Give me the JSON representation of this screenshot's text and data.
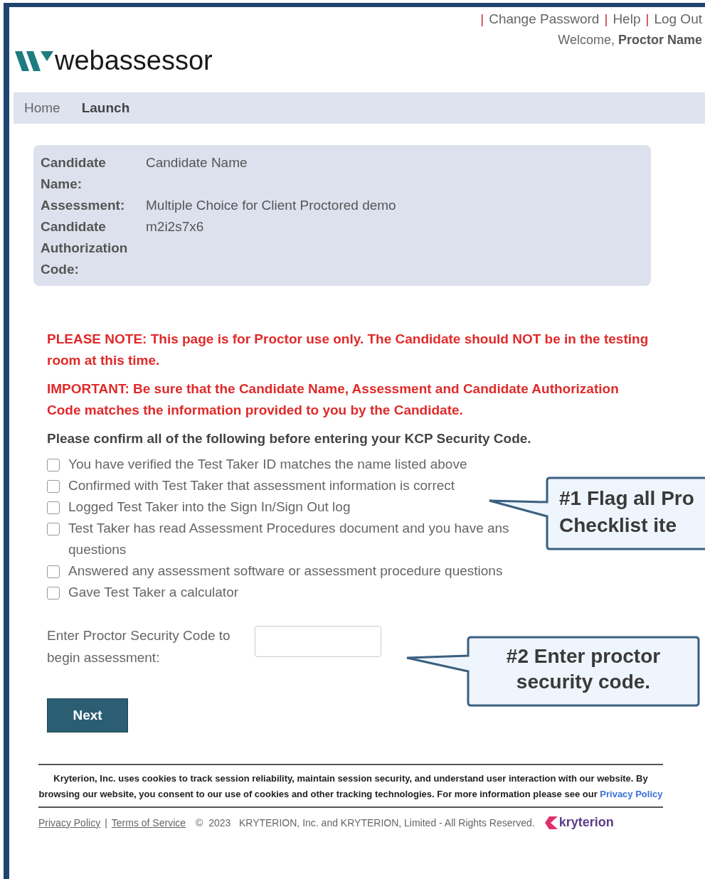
{
  "header": {
    "separator": "|",
    "links": [
      {
        "label": "Change Password"
      },
      {
        "label": "Help"
      },
      {
        "label": "Log Out"
      }
    ],
    "welcome": "Welcome,",
    "user": "Proctor Name"
  },
  "logo": {
    "text": "webassessor"
  },
  "nav": [
    {
      "label": "Home",
      "selected": false
    },
    {
      "label": "Launch",
      "selected": true
    }
  ],
  "candidate_info": [
    {
      "label": "Candidate Name:",
      "value": "Candidate Name"
    },
    {
      "label": "Assessment:",
      "value": "Multiple Choice for Client Proctored demo"
    },
    {
      "label": "Candidate Authorization Code:",
      "value": "m2i2s7x6"
    }
  ],
  "notices": [
    {
      "kind": "warning",
      "text": "PLEASE NOTE: This page is for Proctor use only. The Candidate should NOT be in the testing room at this time."
    },
    {
      "kind": "warning",
      "text": "IMPORTANT: Be sure that the Candidate Name, Assessment and Candidate Authorization Code matches the information provided to you by the Candidate."
    },
    {
      "kind": "instruction",
      "text": "Please confirm all of the following before entering your KCP Security Code."
    }
  ],
  "checklist": [
    {
      "text": "You have verified the Test Taker ID matches the name listed above",
      "checked": false
    },
    {
      "text": "Confirmed with Test Taker that assessment information is correct",
      "checked": false
    },
    {
      "text": "Logged Test Taker into the Sign In/Sign Out log",
      "checked": false
    },
    {
      "text": "Test Taker has read Assessment Procedures document and you have ans",
      "continuation": "questions",
      "checked": false
    },
    {
      "text": "Answered any assessment software or assessment procedure questions",
      "checked": false
    },
    {
      "text": "Gave Test Taker a calculator",
      "checked": false
    }
  ],
  "security_code": {
    "label": "Enter Proctor Security Code to begin assessment:"
  },
  "next_button": "Next",
  "callouts": [
    {
      "lines": [
        "#1 Flag all Pro",
        "Checklist ite"
      ]
    },
    {
      "lines": [
        "#2 Enter proctor",
        "security code."
      ]
    }
  ],
  "footer": {
    "cookie_notice": "Kryterion, Inc. uses cookies to track session reliability, maintain session security, and understand user interaction with our website. By browsing our website, you consent to our use of cookies and other tracking technologies. For more information please see our",
    "cookie_link": "Privacy Policy",
    "separator": "|",
    "links": [
      "Privacy Policy",
      "Terms of Service"
    ],
    "copyright": "©  2023   KRYTERION, Inc. and KRYTERION, Limited - All Rights Reserved.",
    "brand": "kryterion"
  }
}
